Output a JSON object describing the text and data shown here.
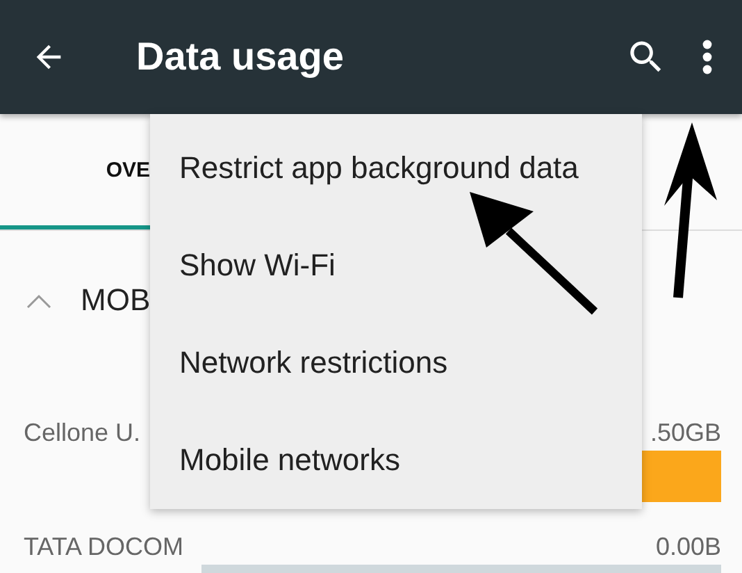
{
  "app_bar": {
    "title": "Data usage"
  },
  "tabs": [
    {
      "label": "OVE",
      "selected": true
    }
  ],
  "section": {
    "label": "MOB",
    "expanded": true
  },
  "usage_rows": [
    {
      "name": "Cellone U.",
      "amount": ".50GB",
      "color": "#fba71b"
    },
    {
      "name": "TATA DOCOM",
      "amount": "0.00B",
      "color": "#cfd8dc"
    }
  ],
  "menu": {
    "items": [
      "Restrict app background data",
      "Show Wi-Fi",
      "Network restrictions",
      "Mobile networks"
    ]
  }
}
